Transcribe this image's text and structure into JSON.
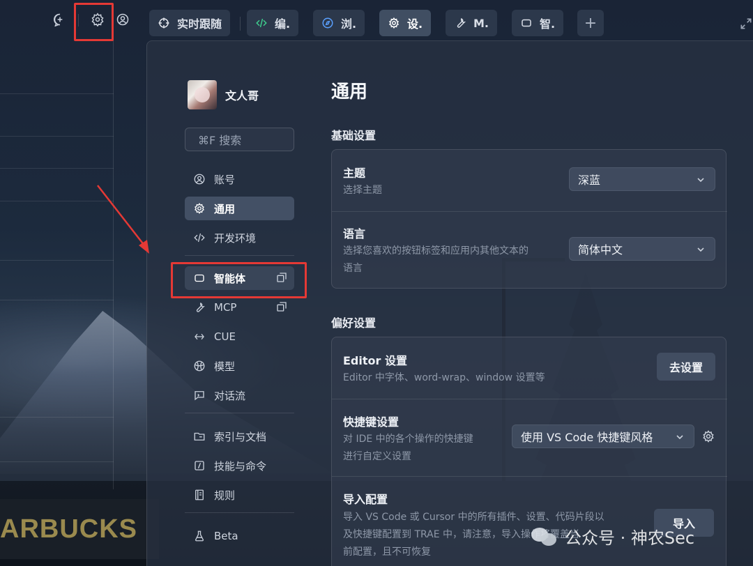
{
  "background": {
    "sign_text": "ARBUCKS"
  },
  "topbar": {
    "icons": [
      "new-chat-icon",
      "gear-icon",
      "user-icon"
    ]
  },
  "tabs": [
    {
      "label": "实时跟随",
      "icon": "crosshair-icon",
      "active": false
    },
    {
      "label": "编.",
      "icon": "code-icon",
      "active": false
    },
    {
      "label": "浏.",
      "icon": "compass-icon",
      "active": false
    },
    {
      "label": "设.",
      "icon": "gear-icon",
      "active": true
    },
    {
      "label": "M.",
      "icon": "wrench-icon",
      "active": false
    },
    {
      "label": "智.",
      "icon": "bot-icon",
      "active": false
    }
  ],
  "tab_add_label": "+",
  "settings": {
    "user_name": "文人哥",
    "search_placeholder": "⌘F 搜索",
    "nav": [
      {
        "label": "账号",
        "icon": "account-icon"
      },
      {
        "label": "通用",
        "icon": "gear-icon",
        "active": true
      },
      {
        "label": "开发环境",
        "icon": "code-icon"
      },
      {
        "label": "智能体",
        "icon": "bot-icon",
        "external": true
      },
      {
        "label": "MCP",
        "icon": "wrench-icon",
        "external": true
      },
      {
        "label": "CUE",
        "icon": "cue-icon"
      },
      {
        "label": "模型",
        "icon": "model-icon"
      },
      {
        "label": "对话流",
        "icon": "chat-flow-icon"
      },
      {
        "label": "索引与文档",
        "icon": "folder-icon"
      },
      {
        "label": "技能与命令",
        "icon": "slash-icon"
      },
      {
        "label": "规则",
        "icon": "rules-icon"
      },
      {
        "label": "Beta",
        "icon": "flask-icon"
      }
    ]
  },
  "main": {
    "title": "通用",
    "basic_section": {
      "title": "基础设置",
      "theme": {
        "title": "主题",
        "desc": "选择主题",
        "value": "深蓝"
      },
      "language": {
        "title": "语言",
        "desc_line1": "选择您喜欢的按钮标签和应用内其他文本的",
        "desc_line2": "语言",
        "value": "简体中文"
      }
    },
    "pref_section": {
      "title": "偏好设置",
      "editor": {
        "title": "Editor 设置",
        "desc": "Editor 中字体、word-wrap、window 设置等",
        "button": "去设置"
      },
      "shortcuts": {
        "title": "快捷键设置",
        "desc_line1": "对 IDE 中的各个操作的快捷键",
        "desc_line2": "进行自定义设置",
        "value": "使用 VS Code 快捷键风格"
      },
      "import": {
        "title": "导入配置",
        "desc_line1": "导入 VS Code 或 Cursor 中的所有插件、设置、代码片段以",
        "desc_line2": "及快捷键配置到 TRAE 中，请注意，导入操作将覆盖当",
        "desc_line3": "前配置，且不可恢复",
        "button": "导入"
      }
    }
  },
  "watermark": {
    "text": "公众号 · 神农Sec"
  },
  "colors": {
    "highlight_red": "#e53935",
    "active_tab_bg": "#4e5c72",
    "code_icon_green": "#3ecf8e",
    "compass_blue": "#5aa0ff"
  }
}
